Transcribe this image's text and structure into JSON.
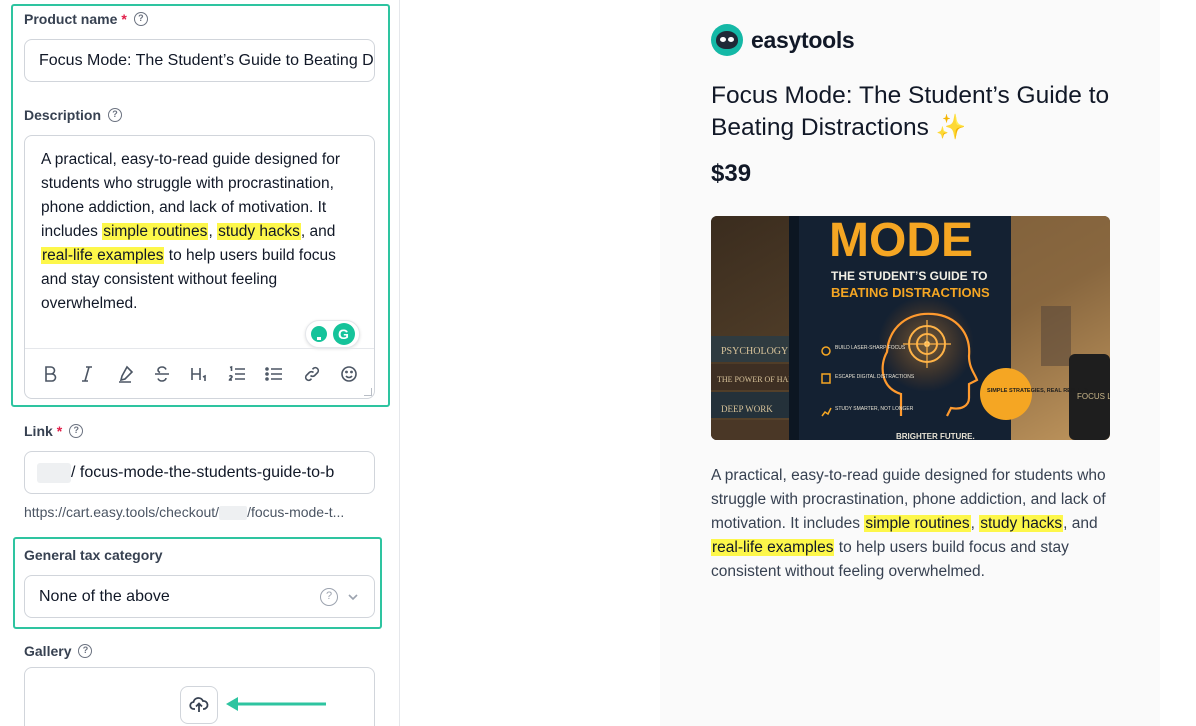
{
  "form": {
    "product_name": {
      "label": "Product name",
      "required": "*",
      "value": "Focus Mode: The Student’s Guide to Beating Distractions"
    },
    "description": {
      "label": "Description",
      "text_1": "A practical, easy-to-read guide designed for students who struggle with procrastination, phone addiction, and lack of motivation. It includes ",
      "highlight_1": "simple routines",
      "text_2": ", ",
      "highlight_2": "study hacks",
      "text_3": ", and ",
      "highlight_3": "real-life examples",
      "text_4": " to help users build focus and stay consistent without feeling overwhelmed."
    },
    "toolbar": [
      "B",
      "I",
      "highlight",
      "S",
      "H1",
      "ordered-list",
      "bullet-list",
      "link",
      "emoji"
    ],
    "link": {
      "label": "Link",
      "required": "*",
      "slug": "/ focus-mode-the-students-guide-to-b",
      "hint_prefix": "https://cart.easy.tools/checkout/",
      "hint_suffix": "/focus-mode-t..."
    },
    "tax": {
      "label": "General tax category",
      "value": "None of the above"
    },
    "gallery": {
      "label": "Gallery"
    },
    "help_glyph": "?"
  },
  "grammarly": {
    "logo": "G"
  },
  "preview": {
    "brand": "easytools",
    "title": "Focus Mode: The Student’s Guide to Beating Distractions",
    "title_emoji": "✨",
    "price": "$39",
    "image": {
      "big_word": "MODE",
      "subtitle_1": "THE STUDENT’S GUIDE TO",
      "subtitle_2": "BEATING DISTRACTIONS",
      "spine_1": "PSYCHOLOGY",
      "spine_2": "THE POWER OF HABIT",
      "spine_3": "DEEP WORK",
      "bullet_1": "BUILD LASER-SHARP FOCUS",
      "bullet_2": "ESCAPE DIGITAL DISTRACTIONS",
      "bullet_3": "STUDY SMARTER, NOT LONGER",
      "badge": "SIMPLE STRATEGIES, REAL RESULTS",
      "mug": "FOCUS LEARN GROW",
      "footer": "BRIGHTER FUTURE."
    },
    "desc_1": "A practical, easy-to-read guide designed for students who struggle with procrastination, phone addiction, and lack of motivation. It includes ",
    "desc_hl_1": "simple routines",
    "desc_2": ", ",
    "desc_hl_2": "study hacks",
    "desc_3": ", and ",
    "desc_hl_3": "real-life examples",
    "desc_4": " to help users build focus and stay consistent without feeling overwhelmed."
  },
  "colors": {
    "accent": "#2ec4a0",
    "highlight": "#fdf74a",
    "brand": "#14b8a6",
    "required": "#e11d48"
  }
}
